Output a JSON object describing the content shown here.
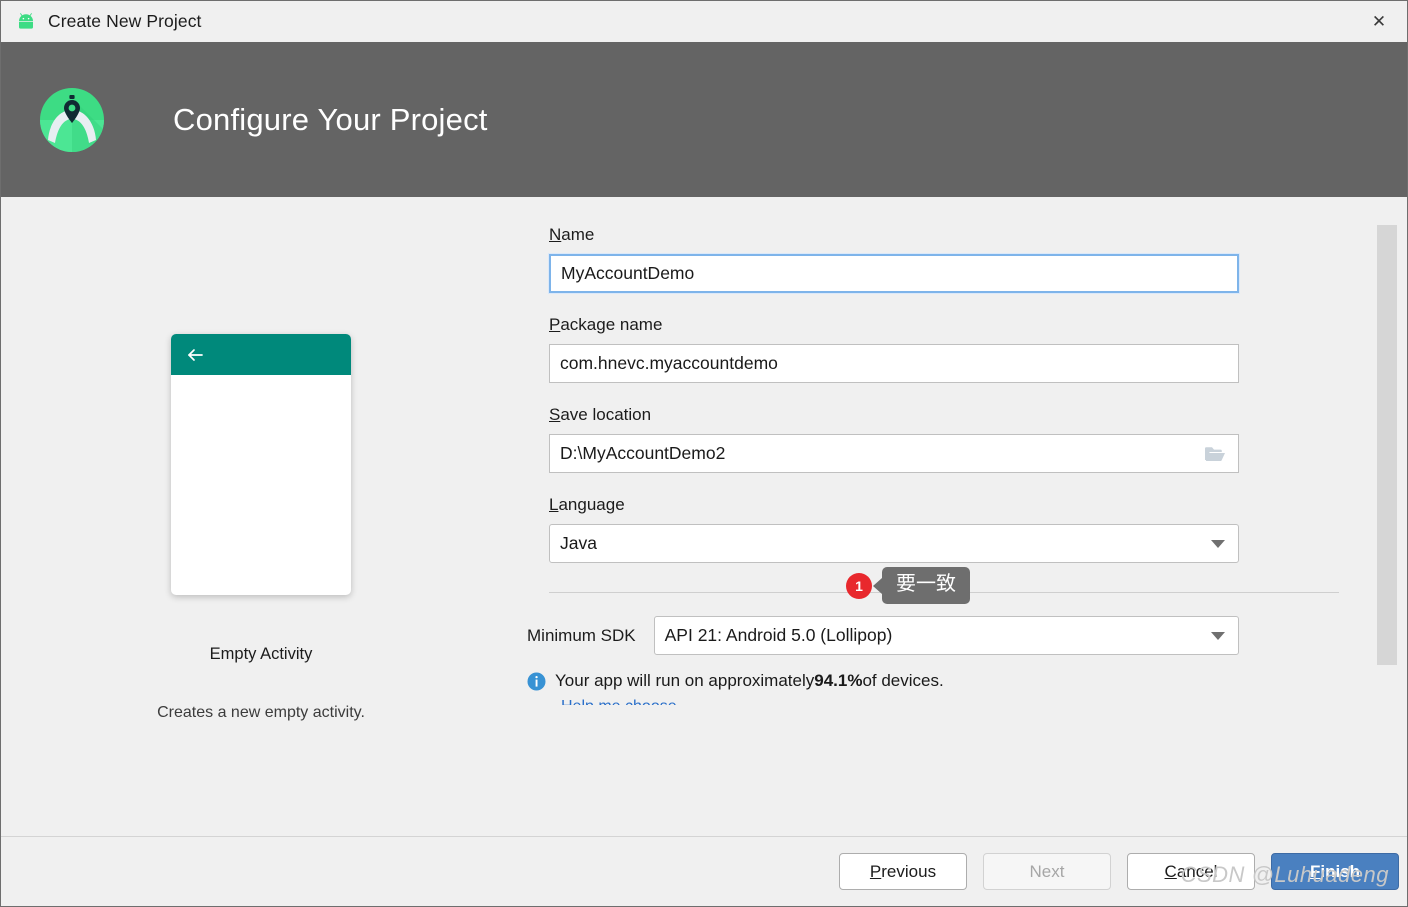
{
  "window": {
    "title": "Create New Project",
    "app_icon": "android-robot-icon",
    "close_label": "✕"
  },
  "header": {
    "title": "Configure Your Project",
    "logo": "android-studio-logo",
    "background": "#646464"
  },
  "preview": {
    "back_icon": "back-arrow-icon",
    "template_name": "Empty Activity",
    "template_description": "Creates a new empty activity.",
    "accent_color": "#00897B"
  },
  "form": {
    "name": {
      "label": "Name",
      "mnemonic": "N",
      "label_rest": "ame",
      "value": "MyAccountDemo",
      "focused": true
    },
    "package_name": {
      "label": "Package name",
      "mnemonic": "P",
      "label_rest": "ackage name",
      "value": "com.hnevc.myaccountdemo"
    },
    "save_location": {
      "label": "Save location",
      "mnemonic": "S",
      "label_rest": "ave location",
      "value": "D:\\MyAccountDemo2",
      "browse_icon": "folder-icon"
    },
    "language": {
      "label": "Language",
      "mnemonic": "L",
      "label_rest": "anguage",
      "value": "Java",
      "dropdown_icon": "chevron-down-icon"
    },
    "minimum_sdk": {
      "label": "Minimum SDK",
      "value": "API 21: Android 5.0 (Lollipop)",
      "dropdown_icon": "chevron-down-icon",
      "note_icon": "info-icon",
      "note_prefix": "Your app will run on approximately ",
      "note_percent": "94.1%",
      "note_suffix": " of devices.",
      "help_link": "Help me choose"
    }
  },
  "annotation": {
    "badge_number": "1",
    "text": "要一致",
    "badge_color": "#E8282D",
    "bubble_color": "#6E6E6E"
  },
  "footer": {
    "previous": {
      "mnemonic": "P",
      "rest": "revious"
    },
    "next": {
      "label": "Next",
      "enabled": false
    },
    "cancel": {
      "mnemonic": "C",
      "prefix": "",
      "rest": "ancel"
    },
    "finish": {
      "mnemonic": "F",
      "rest": "inish",
      "color": "#4A80C0"
    }
  },
  "watermark": "CSDN @Luhuadeng"
}
